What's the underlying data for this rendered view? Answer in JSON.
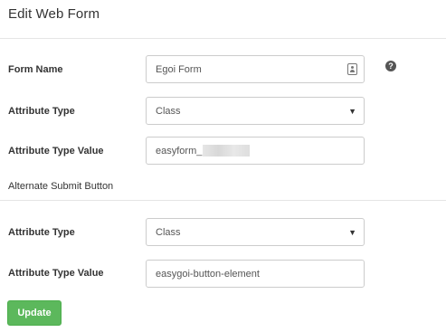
{
  "modal": {
    "title": "Edit Web Form"
  },
  "form": {
    "form_name": {
      "label": "Form Name",
      "value": "Egoi Form"
    },
    "attribute_type": {
      "label": "Attribute Type",
      "selected": "Class"
    },
    "attribute_type_value": {
      "label": "Attribute Type Value",
      "value": "easyform_"
    }
  },
  "alternate_submit": {
    "section_title": "Alternate Submit Button",
    "attribute_type": {
      "label": "Attribute Type",
      "selected": "Class"
    },
    "attribute_type_value": {
      "label": "Attribute Type Value",
      "value": "easygoi-button-element"
    }
  },
  "actions": {
    "update_label": "Update"
  },
  "icons": {
    "help": "question-circle-icon",
    "contact": "contact-card-icon",
    "caret": "chevron-down-icon"
  },
  "colors": {
    "update_button": "#5cb85c",
    "border": "#cccccc"
  }
}
